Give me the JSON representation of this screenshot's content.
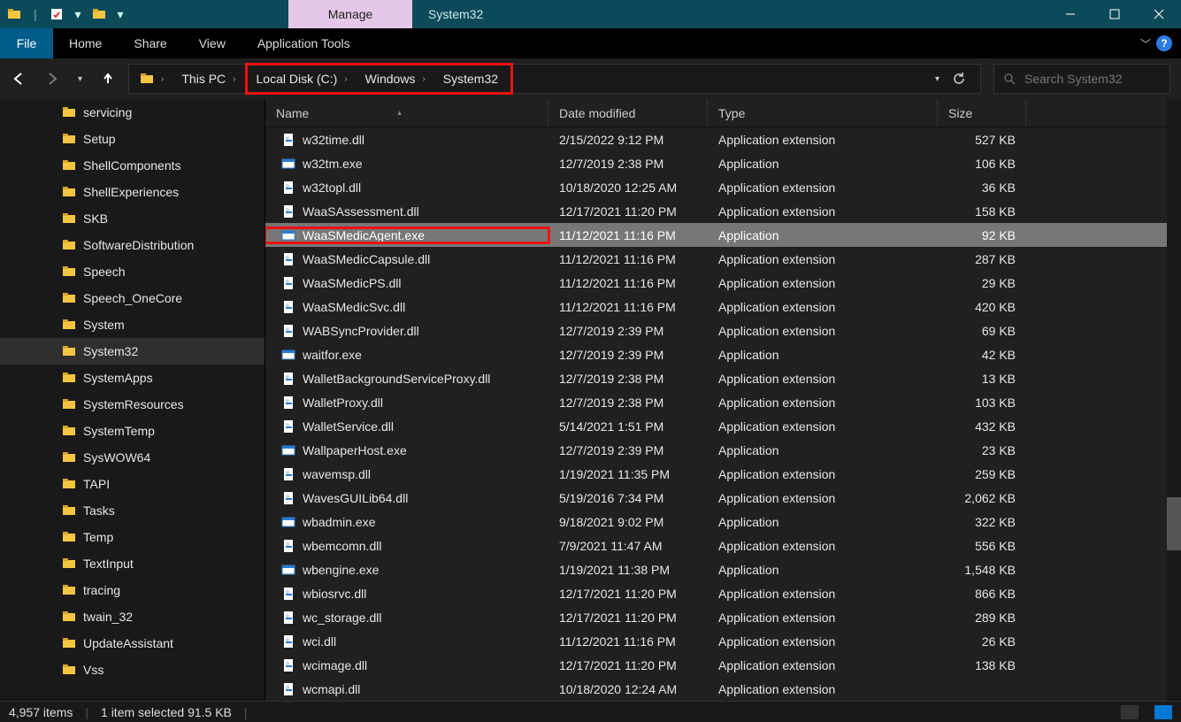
{
  "titlebar": {
    "manage_tab": "Manage",
    "title": "System32"
  },
  "ribbon": {
    "file": "File",
    "items": [
      "Home",
      "Share",
      "View",
      "Application Tools"
    ]
  },
  "breadcrumb": {
    "root_label": "This PC",
    "parts": [
      "Local Disk (C:)",
      "Windows",
      "System32"
    ]
  },
  "search": {
    "placeholder": "Search System32"
  },
  "columns": {
    "name": "Name",
    "date": "Date modified",
    "type": "Type",
    "size": "Size"
  },
  "tree": {
    "items": [
      {
        "label": "servicing"
      },
      {
        "label": "Setup"
      },
      {
        "label": "ShellComponents"
      },
      {
        "label": "ShellExperiences"
      },
      {
        "label": "SKB"
      },
      {
        "label": "SoftwareDistribution"
      },
      {
        "label": "Speech"
      },
      {
        "label": "Speech_OneCore"
      },
      {
        "label": "System"
      },
      {
        "label": "System32",
        "selected": true
      },
      {
        "label": "SystemApps"
      },
      {
        "label": "SystemResources"
      },
      {
        "label": "SystemTemp"
      },
      {
        "label": "SysWOW64"
      },
      {
        "label": "TAPI"
      },
      {
        "label": "Tasks"
      },
      {
        "label": "Temp"
      },
      {
        "label": "TextInput"
      },
      {
        "label": "tracing"
      },
      {
        "label": "twain_32"
      },
      {
        "label": "UpdateAssistant"
      },
      {
        "label": "Vss"
      }
    ]
  },
  "files": [
    {
      "name": "w32time.dll",
      "date": "2/15/2022 9:12 PM",
      "type": "Application extension",
      "size": "527 KB",
      "icon": "dll"
    },
    {
      "name": "w32tm.exe",
      "date": "12/7/2019 2:38 PM",
      "type": "Application",
      "size": "106 KB",
      "icon": "exe"
    },
    {
      "name": "w32topl.dll",
      "date": "10/18/2020 12:25 AM",
      "type": "Application extension",
      "size": "36 KB",
      "icon": "dll"
    },
    {
      "name": "WaaSAssessment.dll",
      "date": "12/17/2021 11:20 PM",
      "type": "Application extension",
      "size": "158 KB",
      "icon": "dll"
    },
    {
      "name": "WaaSMedicAgent.exe",
      "date": "11/12/2021 11:16 PM",
      "type": "Application",
      "size": "92 KB",
      "icon": "exe",
      "selected": true,
      "callout": true
    },
    {
      "name": "WaaSMedicCapsule.dll",
      "date": "11/12/2021 11:16 PM",
      "type": "Application extension",
      "size": "287 KB",
      "icon": "dll"
    },
    {
      "name": "WaaSMedicPS.dll",
      "date": "11/12/2021 11:16 PM",
      "type": "Application extension",
      "size": "29 KB",
      "icon": "dll"
    },
    {
      "name": "WaaSMedicSvc.dll",
      "date": "11/12/2021 11:16 PM",
      "type": "Application extension",
      "size": "420 KB",
      "icon": "dll"
    },
    {
      "name": "WABSyncProvider.dll",
      "date": "12/7/2019 2:39 PM",
      "type": "Application extension",
      "size": "69 KB",
      "icon": "dll"
    },
    {
      "name": "waitfor.exe",
      "date": "12/7/2019 2:39 PM",
      "type": "Application",
      "size": "42 KB",
      "icon": "exe"
    },
    {
      "name": "WalletBackgroundServiceProxy.dll",
      "date": "12/7/2019 2:38 PM",
      "type": "Application extension",
      "size": "13 KB",
      "icon": "dll"
    },
    {
      "name": "WalletProxy.dll",
      "date": "12/7/2019 2:38 PM",
      "type": "Application extension",
      "size": "103 KB",
      "icon": "dll"
    },
    {
      "name": "WalletService.dll",
      "date": "5/14/2021 1:51 PM",
      "type": "Application extension",
      "size": "432 KB",
      "icon": "dll"
    },
    {
      "name": "WallpaperHost.exe",
      "date": "12/7/2019 2:39 PM",
      "type": "Application",
      "size": "23 KB",
      "icon": "exe"
    },
    {
      "name": "wavemsp.dll",
      "date": "1/19/2021 11:35 PM",
      "type": "Application extension",
      "size": "259 KB",
      "icon": "dll"
    },
    {
      "name": "WavesGUILib64.dll",
      "date": "5/19/2016 7:34 PM",
      "type": "Application extension",
      "size": "2,062 KB",
      "icon": "dll"
    },
    {
      "name": "wbadmin.exe",
      "date": "9/18/2021 9:02 PM",
      "type": "Application",
      "size": "322 KB",
      "icon": "exe"
    },
    {
      "name": "wbemcomn.dll",
      "date": "7/9/2021 11:47 AM",
      "type": "Application extension",
      "size": "556 KB",
      "icon": "dll"
    },
    {
      "name": "wbengine.exe",
      "date": "1/19/2021 11:38 PM",
      "type": "Application",
      "size": "1,548 KB",
      "icon": "exe"
    },
    {
      "name": "wbiosrvc.dll",
      "date": "12/17/2021 11:20 PM",
      "type": "Application extension",
      "size": "866 KB",
      "icon": "dll"
    },
    {
      "name": "wc_storage.dll",
      "date": "12/17/2021 11:20 PM",
      "type": "Application extension",
      "size": "289 KB",
      "icon": "dll"
    },
    {
      "name": "wci.dll",
      "date": "11/12/2021 11:16 PM",
      "type": "Application extension",
      "size": "26 KB",
      "icon": "dll"
    },
    {
      "name": "wcimage.dll",
      "date": "12/17/2021 11:20 PM",
      "type": "Application extension",
      "size": "138 KB",
      "icon": "dll"
    },
    {
      "name": "wcmapi.dll",
      "date": "10/18/2020 12:24 AM",
      "type": "Application extension",
      "size": "",
      "icon": "dll"
    }
  ],
  "status": {
    "count": "4,957 items",
    "selection": "1 item selected  91.5 KB"
  }
}
